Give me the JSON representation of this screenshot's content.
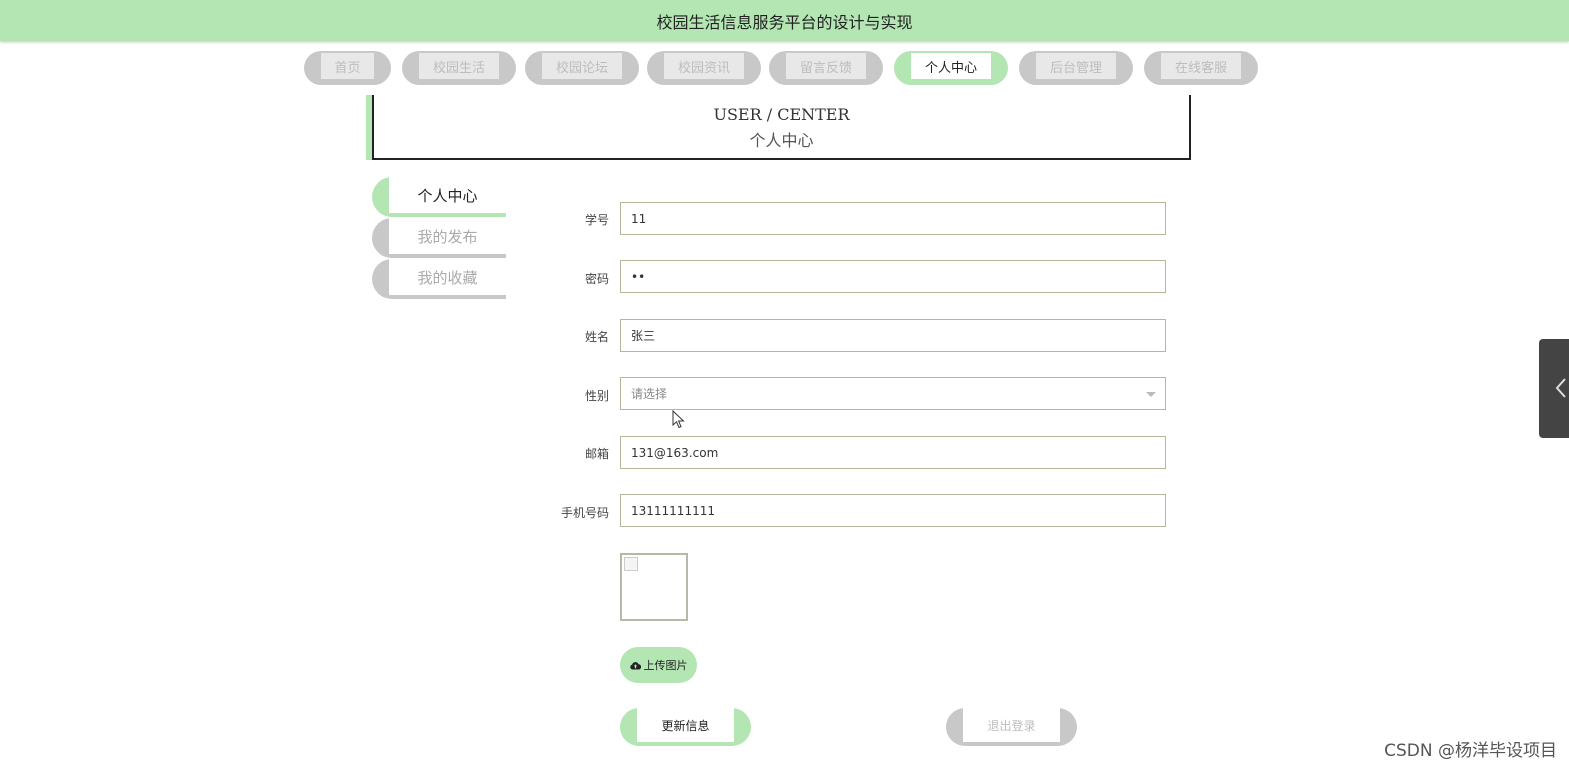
{
  "header": {
    "title": "校园生活信息服务平台的设计与实现"
  },
  "nav": {
    "items": [
      {
        "label": "首页"
      },
      {
        "label": "校园生活"
      },
      {
        "label": "校园论坛"
      },
      {
        "label": "校园资讯"
      },
      {
        "label": "留言反馈"
      },
      {
        "label": "个人中心",
        "active": true
      },
      {
        "label": "后台管理"
      },
      {
        "label": "在线客服"
      }
    ]
  },
  "banner": {
    "en": "USER / CENTER",
    "cn": "个人中心"
  },
  "sidebar": {
    "items": [
      {
        "label": "个人中心",
        "active": true
      },
      {
        "label": "我的发布"
      },
      {
        "label": "我的收藏"
      }
    ]
  },
  "form": {
    "student_id": {
      "label": "学号",
      "value": "11"
    },
    "password": {
      "label": "密码",
      "value": "••"
    },
    "name": {
      "label": "姓名",
      "value": "张三"
    },
    "gender": {
      "label": "性别",
      "placeholder": "请选择"
    },
    "email": {
      "label": "邮箱",
      "value": "131@163.com"
    },
    "phone": {
      "label": "手机号码",
      "value": "13111111111"
    }
  },
  "upload": {
    "label": "上传图片",
    "icon": "cloud-upload-icon"
  },
  "actions": {
    "update_label": "更新信息",
    "logout_label": "退出登录"
  },
  "watermark": "CSDN @杨洋毕设项目",
  "colors": {
    "accent": "#b3e6b3",
    "inactive": "#c8c8c8"
  }
}
